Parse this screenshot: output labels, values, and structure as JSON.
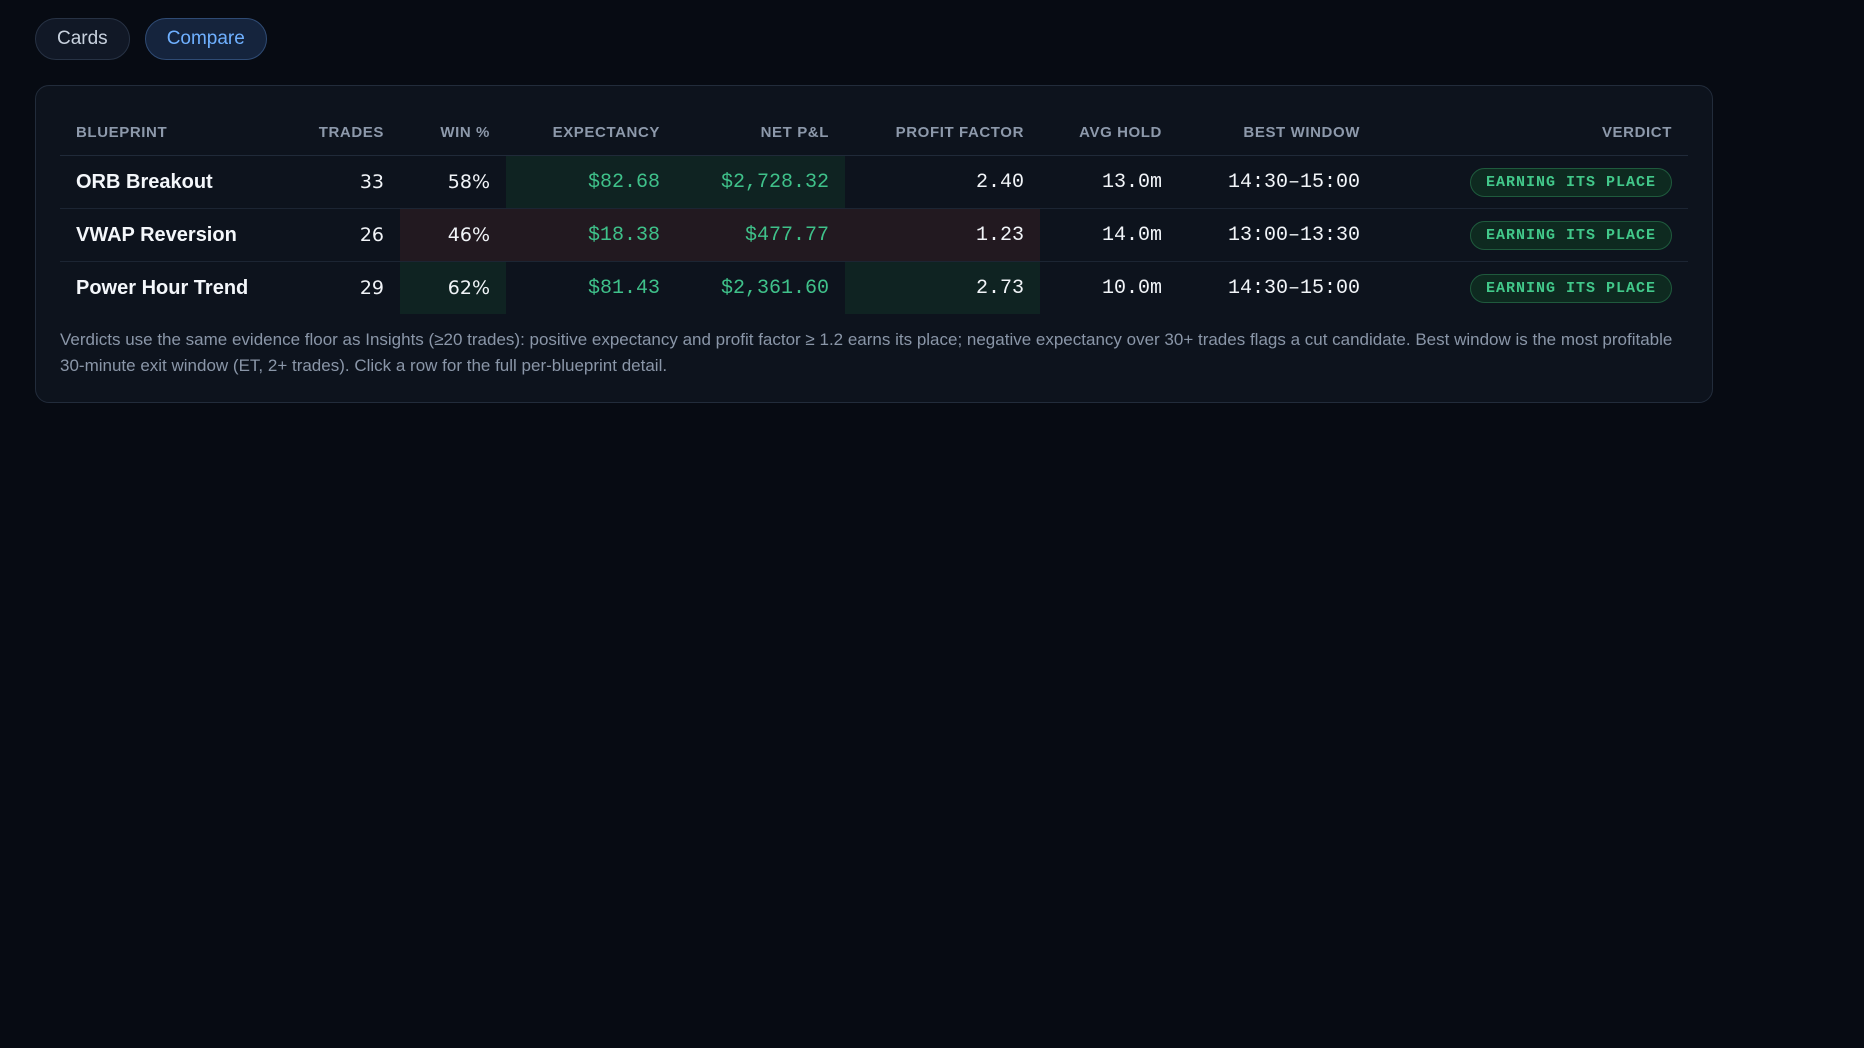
{
  "tabs": [
    {
      "label": "Cards",
      "active": false
    },
    {
      "label": "Compare",
      "active": true
    }
  ],
  "table": {
    "headers": {
      "blueprint": "BLUEPRINT",
      "trades": "TRADES",
      "win": "WIN %",
      "expectancy": "EXPECTANCY",
      "net": "NET P&L",
      "pf": "PROFIT FACTOR",
      "hold": "AVG HOLD",
      "window": "BEST WINDOW",
      "verdict": "VERDICT"
    },
    "rows": [
      {
        "name": "ORB Breakout",
        "trades": "33",
        "win": "58%",
        "expectancy": "$82.68",
        "net": "$2,728.32",
        "pf": "2.40",
        "hold": "13.0m",
        "window": "14:30–15:00",
        "verdict": "EARNING ITS PLACE"
      },
      {
        "name": "VWAP Reversion",
        "trades": "26",
        "win": "46%",
        "expectancy": "$18.38",
        "net": "$477.77",
        "pf": "1.23",
        "hold": "14.0m",
        "window": "13:00–13:30",
        "verdict": "EARNING ITS PLACE"
      },
      {
        "name": "Power Hour Trend",
        "trades": "29",
        "win": "62%",
        "expectancy": "$81.43",
        "net": "$2,361.60",
        "pf": "2.73",
        "hold": "10.0m",
        "window": "14:30–15:00",
        "verdict": "EARNING ITS PLACE"
      }
    ]
  },
  "footnote": "Verdicts use the same evidence floor as Insights (≥20 trades): positive expectancy and profit factor ≥ 1.2 earns its place; negative expectancy over 30+ trades flags a cut candidate. Best window is the most profitable 30-minute exit window (ET, 2+ trades). Click a row for the full per-blueprint detail.",
  "colors": {
    "background": "#070b13",
    "panel": "#0d131d",
    "positive": "#3fc18a",
    "accent": "#6fb0ff",
    "cell_good": "#0f2322",
    "cell_weak": "#221920"
  }
}
